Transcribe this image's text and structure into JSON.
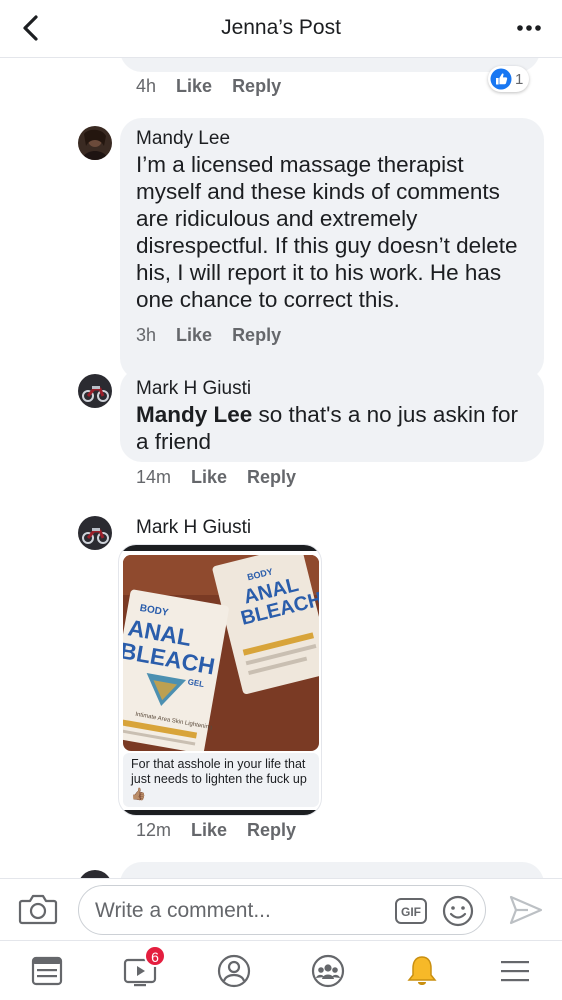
{
  "header": {
    "title": "Jenna’s Post"
  },
  "comments": [
    {
      "time": "4h",
      "like": "Like",
      "reply": "Reply",
      "reaction_count": "1"
    },
    {
      "author": "Mandy Lee",
      "text": "I’m a licensed massage therapist myself and these kinds of comments are ridiculous and extremely disrespectful. If this guy doesn’t delete his, I will report it to his work. He has one chance to correct this.",
      "time": "3h",
      "like": "Like",
      "reply": "Reply"
    },
    {
      "author": "Mark H Giusti",
      "mention": "Mandy Lee",
      "text": " so that's a no jus askin for a friend",
      "time": "14m",
      "like": "Like",
      "reply": "Reply"
    },
    {
      "author": "Mark H Giusti",
      "attachment": {
        "product_brand": "BODY",
        "product_name_line1": "ANAL",
        "product_name_line2": "BLEACH",
        "product_suffix": "GEL",
        "product_subtitle": "Intimate Area Skin Lightening",
        "caption": "For that asshole in your life that just needs to lighten the fuck up",
        "caption_emoji": "👍🏽"
      },
      "time": "12m",
      "like": "Like",
      "reply": "Reply"
    }
  ],
  "composer": {
    "placeholder": "Write a comment...",
    "gif_label": "GIF"
  },
  "tabbar": {
    "watch_badge": "6"
  },
  "colors": {
    "accent": "#1877f2",
    "bubble": "#f0f2f5",
    "badge": "#e41e3f",
    "bell": "#f7b928"
  }
}
